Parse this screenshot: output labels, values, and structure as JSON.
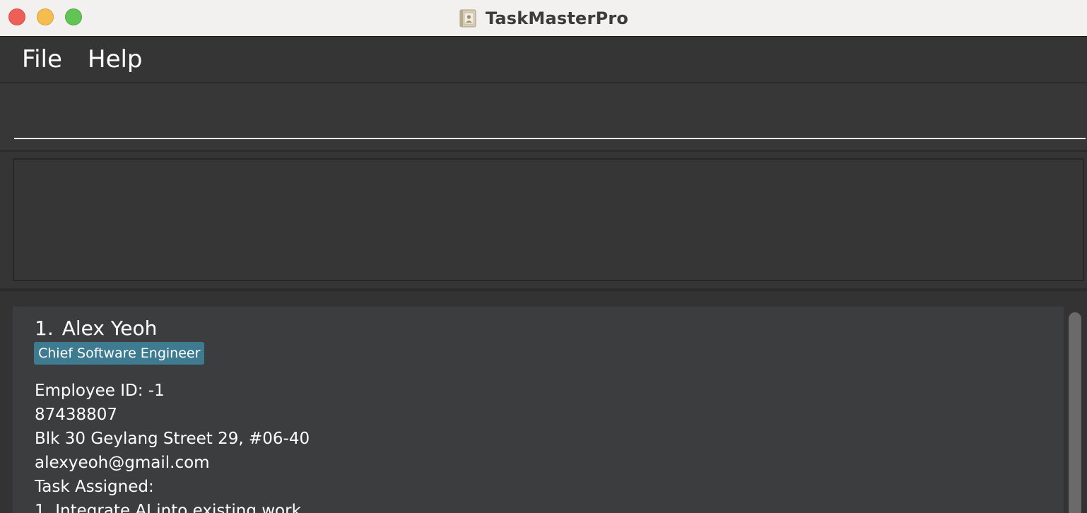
{
  "window": {
    "title": "TaskMasterPro",
    "app_icon": "address-book-icon"
  },
  "menu": {
    "file_label": "File",
    "help_label": "Help"
  },
  "command_box": {
    "value": "",
    "placeholder": ""
  },
  "result_display": {
    "text": ""
  },
  "employees": [
    {
      "index": "1.",
      "name": "Alex Yeoh",
      "role": "Chief Software Engineer",
      "employee_id": "Employee ID: -1",
      "phone": "87438807",
      "address": "Blk 30 Geylang Street 29, #06-40",
      "email": "alexyeoh@gmail.com",
      "tasks_heading": "Task Assigned:",
      "tasks": [
        "1. Integrate AI into existing work"
      ]
    }
  ],
  "colors": {
    "tag_background": "#3e7b91",
    "card_background": "#3c3d3f",
    "window_background": "#353535",
    "close_button": "#ee5f57",
    "minimize_button": "#f5bd4f",
    "maximize_button": "#61c454"
  }
}
